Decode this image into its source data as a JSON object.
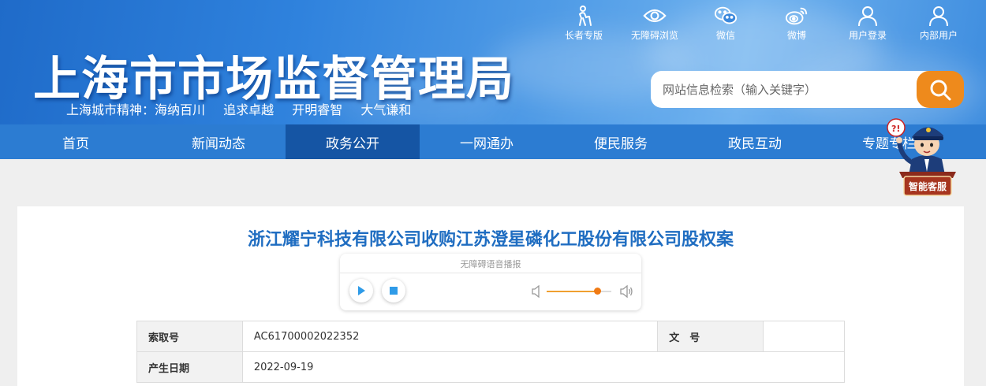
{
  "header": {
    "site_title": "上海市市场监督管理局",
    "slogan": [
      "上海城市精神：海纳百川",
      "追求卓越",
      "开明睿智",
      "大气谦和"
    ],
    "top_links": [
      {
        "label": "长者专版",
        "icon": "elderly-icon"
      },
      {
        "label": "无障碍浏览",
        "icon": "eye-icon"
      },
      {
        "label": "微信",
        "icon": "wechat-icon"
      },
      {
        "label": "微博",
        "icon": "weibo-icon"
      },
      {
        "label": "用户登录",
        "icon": "user-icon"
      },
      {
        "label": "内部用户",
        "icon": "user-icon"
      }
    ],
    "search": {
      "placeholder": "网站信息检索（输入关键字）"
    }
  },
  "nav": {
    "items": [
      "首页",
      "新闻动态",
      "政务公开",
      "一网通办",
      "便民服务",
      "政民互动",
      "专题专栏"
    ],
    "active": "政务公开"
  },
  "assistant": {
    "label": "智能客服"
  },
  "article": {
    "title": "浙江耀宁科技有限公司收购江苏澄星磷化工股份有限公司股权案",
    "player": {
      "label": "无障碍语音播报",
      "volume_fraction": 0.78
    },
    "meta": {
      "index_label": "索取号",
      "index_value": "AC61700002022352",
      "doc_no_label": "文　号",
      "doc_no_value": "",
      "date_label": "产生日期",
      "date_value": "2022-09-19"
    }
  },
  "colors": {
    "header_blue": "#2f82dd",
    "nav_blue": "#2c7cd2",
    "nav_active": "#1555a4",
    "title_blue": "#1f6dc1",
    "search_orange": "#ee8a1c"
  }
}
